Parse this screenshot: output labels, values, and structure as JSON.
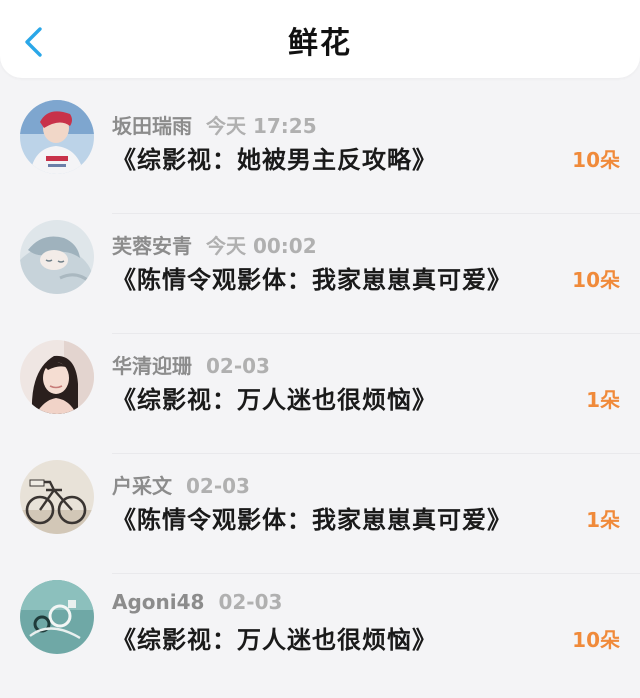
{
  "header": {
    "title": "鲜花",
    "back_icon": "chevron-left-icon"
  },
  "colors": {
    "accent": "#2aa7e8",
    "count": "#f08a3a",
    "name": "#8c8c8c"
  },
  "items": [
    {
      "name": "坂田瑞雨",
      "time": "今天 17:25",
      "work": "《综影视：她被男主反攻略》",
      "count": "10朵",
      "avatar": "avatar-boy-red-hair"
    },
    {
      "name": "芙蓉安青",
      "time": "今天 00:02",
      "work": "《陈情令观影体：我家崽崽真可爱》",
      "count": "10朵",
      "avatar": "avatar-anime-sleeping"
    },
    {
      "name": "华清迎珊",
      "time": "02-03",
      "work": "《综影视：万人迷也很烦恼》",
      "count": "1朵",
      "avatar": "avatar-girl-portrait"
    },
    {
      "name": "户采文",
      "time": "02-03",
      "work": "《陈情令观影体：我家崽崽真可爱》",
      "count": "1朵",
      "avatar": "avatar-bicycle"
    },
    {
      "name": "Agoni48",
      "time": "02-03",
      "work": "《综影视：万人迷也很烦恼》",
      "count": "10朵",
      "avatar": "avatar-teal-abstract"
    }
  ]
}
